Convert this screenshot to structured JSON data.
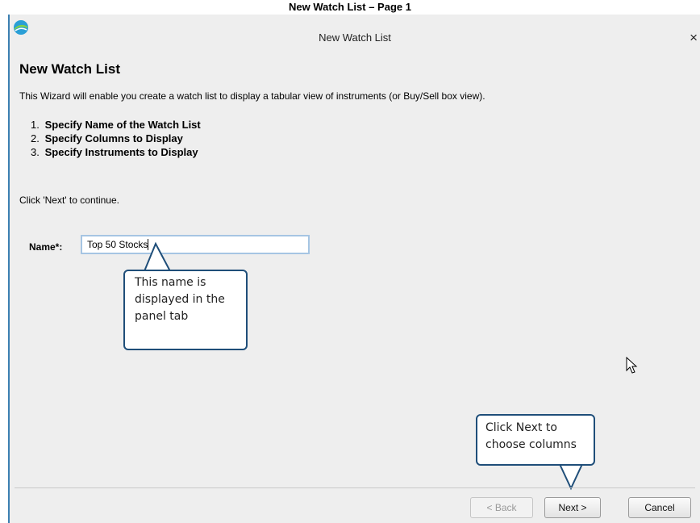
{
  "caption": "New Watch List – Page 1",
  "window": {
    "title": "New Watch List",
    "close_glyph": "×",
    "icon": "app-logo-icon"
  },
  "content": {
    "heading": "New Watch List",
    "description": "This Wizard will enable you create a watch list to display a tabular view of instruments (or Buy/Sell box view).",
    "steps": [
      {
        "num": "1.",
        "label": "Specify Name of the Watch List"
      },
      {
        "num": "2.",
        "label": "Specify Columns to Display"
      },
      {
        "num": "3.",
        "label": "Specify Instruments to Display"
      }
    ],
    "hint": "Click 'Next' to continue."
  },
  "form": {
    "name_label": "Name*:",
    "name_value": "Top 50 Stocks"
  },
  "callouts": {
    "name_note": [
      "This name is",
      "displayed in the",
      "panel tab"
    ],
    "next_note": [
      "Click Next to",
      "choose columns"
    ]
  },
  "buttons": {
    "back": "< Back",
    "next": "Next >",
    "cancel": "Cancel"
  },
  "colors": {
    "window_border": "#3c7fb1",
    "callout_border": "#1f4e79",
    "input_border": "#a6c5e3"
  }
}
